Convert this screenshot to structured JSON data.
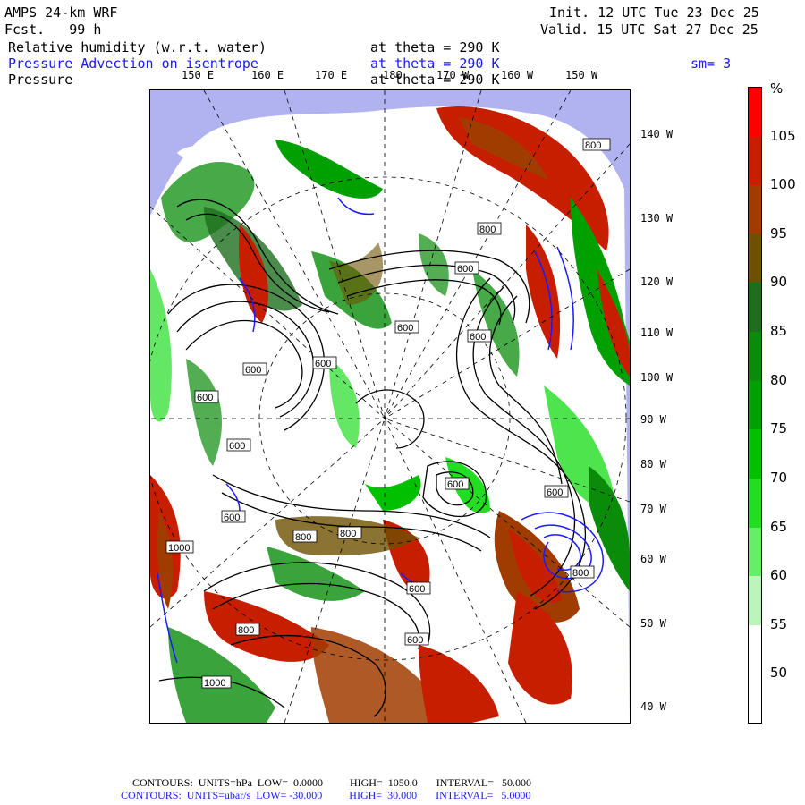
{
  "header": {
    "model": "AMPS 24-km WRF",
    "fcst": "Fcst.   99 h",
    "init": "Init. 12 UTC Tue 23 Dec 25",
    "valid": "Valid. 15 UTC Sat 27 Dec 25",
    "field1": "Relative humidity (w.r.t. water)",
    "field1_level": "at theta = 290 K",
    "field2": "Pressure Advection on isentrope",
    "field2_level": "at theta = 290 K",
    "field2_smooth": "sm= 3",
    "field3": "Pressure",
    "field3_level": "at theta = 290 K"
  },
  "top_longitudes": [
    "150 E",
    "160 E",
    "170 E",
    "180",
    "170 W",
    "160 W",
    "150 W"
  ],
  "right_longitudes": [
    "140 W",
    "130 W",
    "120 W",
    "110 W",
    "100 W",
    "90 W",
    "80 W",
    "70 W",
    "60 W",
    "50 W",
    "40 W"
  ],
  "colorbar": {
    "unit": "%",
    "labels": [
      "105",
      "100",
      "95",
      "90",
      "85",
      "80",
      "75",
      "70",
      "65",
      "60",
      "55",
      "50"
    ],
    "colors": [
      "#ff0000",
      "#c81e00",
      "#a03c00",
      "#6e5000",
      "#1e6e1e",
      "#0a8c0a",
      "#00a000",
      "#00c000",
      "#22dd22",
      "#66ee66",
      "#bbf5bb",
      "#ffffff",
      "#ffffff"
    ]
  },
  "contour_labels": [
    "800",
    "800",
    "600",
    "600",
    "600",
    "600",
    "600",
    "600",
    "600",
    "600",
    "600",
    "600",
    "800",
    "800",
    "1000",
    "800",
    "800",
    "600",
    "600",
    "1000"
  ],
  "footer": {
    "line1": "CONTOURS:  UNITS=hPa  LOW=  0.0000          HIGH=  1050.0       INTERVAL=   50.000",
    "line2": "CONTOURS:  UNITS=ubar/s  LOW= -30.000          HIGH=  30.000       INTERVAL=   5.0000"
  }
}
